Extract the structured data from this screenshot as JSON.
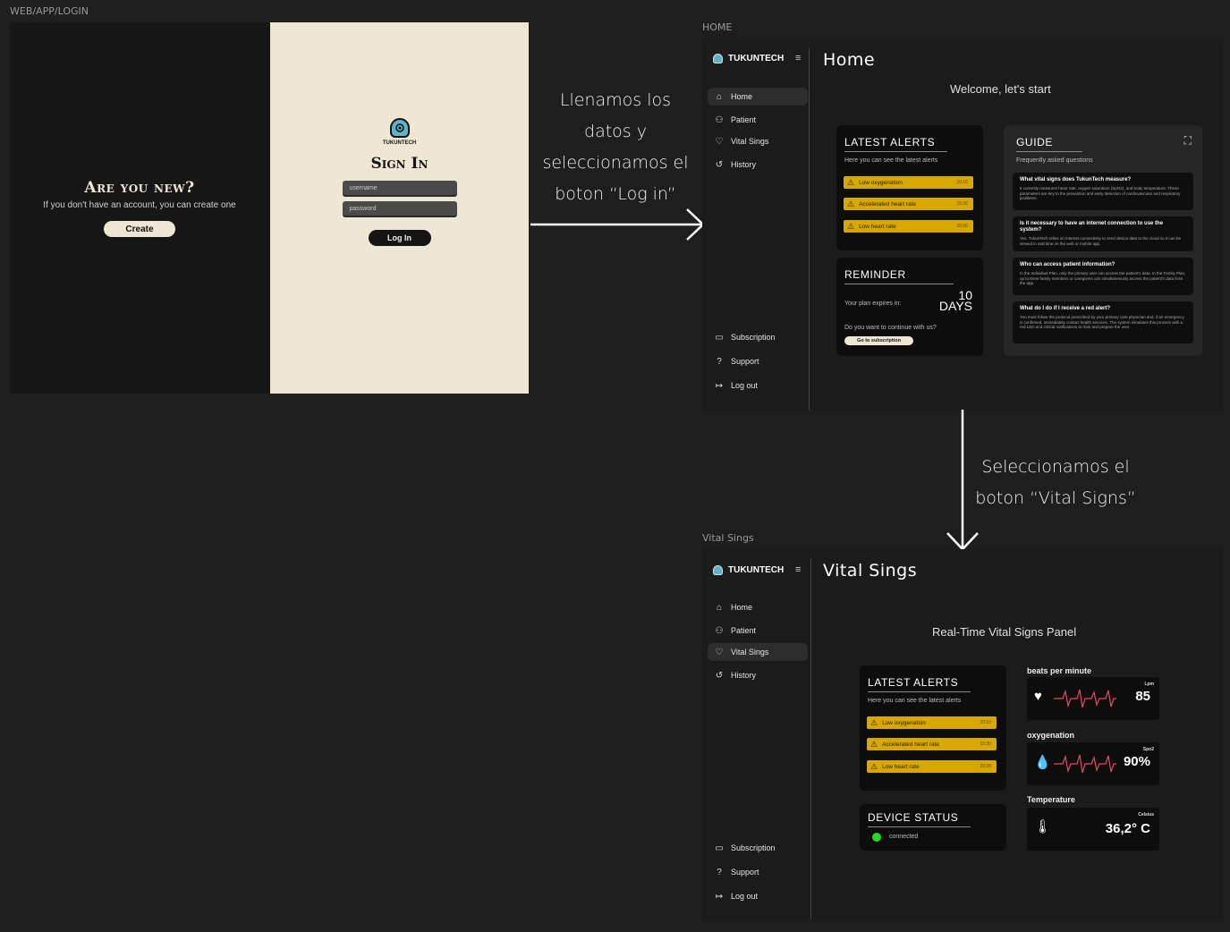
{
  "labels": {
    "login_frame": "WEB/APP/LOGIN",
    "home_frame": "HOME",
    "vital_frame": "Vital Sings"
  },
  "login": {
    "new_title": "Are you new?",
    "new_sub": "If you don't have an account, you can create one",
    "create_label": "Create",
    "brand": "TUKUNTECH",
    "signin_title": "Sign In",
    "username_placeholder": "username",
    "password_placeholder": "password",
    "login_label": "Log In"
  },
  "annotations": {
    "step1": [
      "Llenamos los",
      "datos y",
      "seleccionamos el",
      "boton “Log in”"
    ],
    "step2": [
      "Seleccionamos el",
      "boton “Vital Signs”"
    ]
  },
  "sidebar": {
    "brand": "TUKUNTECH",
    "items": [
      {
        "label": "Home",
        "icon": "home-icon"
      },
      {
        "label": "Patient",
        "icon": "patient-icon"
      },
      {
        "label": "Vital Sings",
        "icon": "heart-icon"
      },
      {
        "label": "History",
        "icon": "history-icon"
      }
    ],
    "bottom": [
      {
        "label": "Subscription",
        "icon": "card-icon"
      },
      {
        "label": "Support",
        "icon": "help-icon"
      },
      {
        "label": "Log out",
        "icon": "logout-icon"
      }
    ]
  },
  "home": {
    "title": "Home",
    "welcome": "Welcome, let's start",
    "alerts_title": "LATEST ALERTS",
    "alerts_sub": "Here you can see the latest alerts",
    "alerts": [
      {
        "label": "Low oxygenation",
        "time": "10:10"
      },
      {
        "label": "Accelerated heart rate",
        "time": "15:30"
      },
      {
        "label": "Low heart rate",
        "time": "20:20"
      }
    ],
    "reminder_title": "REMINDER",
    "reminder_text": "Your plan expires in:",
    "reminder_num": "10",
    "reminder_unit": "DAYS",
    "reminder_q": "Do you want to continue with us?",
    "reminder_btn": "Go to subscription",
    "guide_title": "GUIDE",
    "guide_sub": "Frequently asked questions",
    "faq": [
      {
        "q": "What vital signs does TukunTech measure?",
        "a": "It currently measures heart rate, oxygen saturation (SpO2), and body temperature. These parameters are key to the prevention and early detection of cardiovascular and respiratory problems."
      },
      {
        "q": "Is it necessary to have an internet connection to use the system?",
        "a": "Yes, TukunTech relies on internet connectivity to send device data to the cloud so it can be viewed in real time on the web or mobile app."
      },
      {
        "q": "Who can access patient information?",
        "a": "In the Individual Plan, only the primary user can access the patient's data. In the Family Plan, up to three family members or caregivers can simultaneously access the patient's data from the app."
      },
      {
        "q": "What do I do if I receive a red alert?",
        "a": "You must follow the protocol prescribed by your primary care physician and, if an emergency is confirmed, immediately contact health services. The system simulates this process with a red LED and critical notifications to train and prepare the user."
      }
    ]
  },
  "vital": {
    "title": "Vital Sings",
    "panel_title": "Real-Time Vital Signs Panel",
    "alerts_title": "LATEST ALERTS",
    "alerts_sub": "Here you can see the latest alerts",
    "alerts": [
      {
        "label": "Low oxygenation",
        "time": "10:10"
      },
      {
        "label": "Accelerated heart rate",
        "time": "15:30"
      },
      {
        "label": "Low heart rate",
        "time": "20:20"
      }
    ],
    "device_title": "DEVICE STATUS",
    "device_status": "connected",
    "bpm_label": "beats per minute",
    "bpm_unit": "Lpm",
    "bpm_value": "85",
    "oxy_label": "oxygenation",
    "oxy_unit": "Spo2",
    "oxy_value": "90%",
    "temp_label": "Temperature",
    "temp_unit": "Celsius",
    "temp_value": "36,2° C"
  },
  "colors": {
    "alert": "#d8a800",
    "accent": "#e84a5f",
    "ok": "#22dd22",
    "cream": "#efe6d4"
  }
}
